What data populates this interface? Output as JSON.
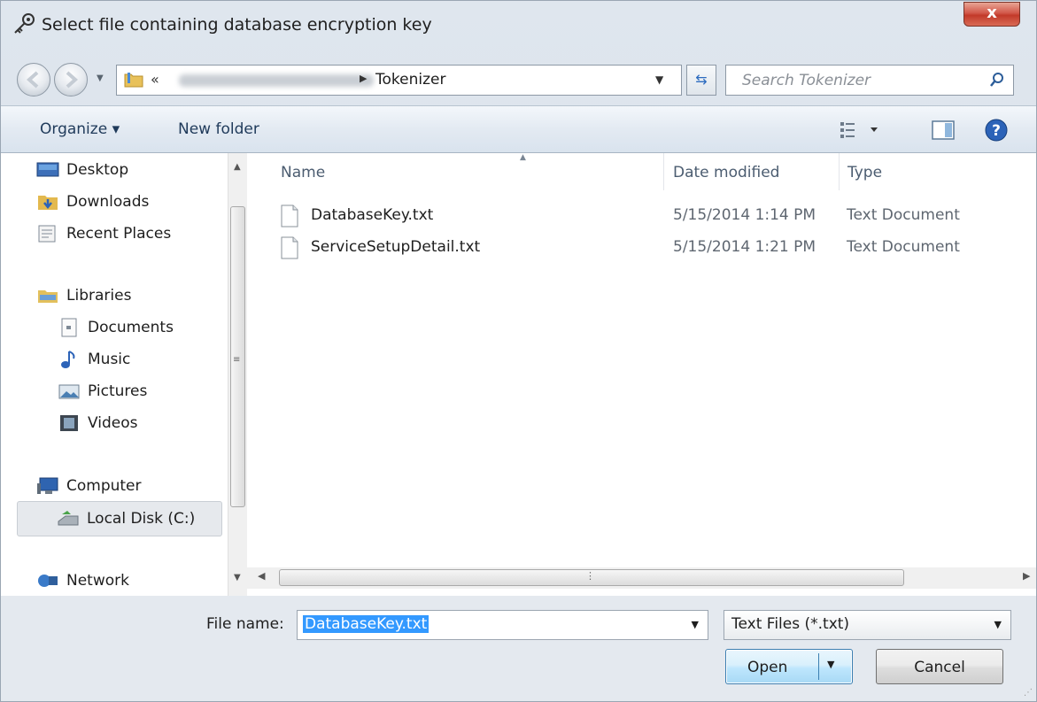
{
  "window": {
    "title": "Select file containing database encryption key",
    "close_label": "x"
  },
  "address": {
    "prefix": "«",
    "current_folder": "Tokenizer",
    "search_placeholder": "Search Tokenizer"
  },
  "toolbar": {
    "organize_label": "Organize ▾",
    "new_folder_label": "New folder"
  },
  "navpane": {
    "items": [
      {
        "label": "Desktop",
        "icon": "desktop-icon"
      },
      {
        "label": "Downloads",
        "icon": "downloads-icon"
      },
      {
        "label": "Recent Places",
        "icon": "recent-places-icon"
      },
      {
        "label": "Libraries",
        "icon": "libraries-icon"
      },
      {
        "label": "Documents",
        "icon": "documents-icon"
      },
      {
        "label": "Music",
        "icon": "music-icon"
      },
      {
        "label": "Pictures",
        "icon": "pictures-icon"
      },
      {
        "label": "Videos",
        "icon": "videos-icon"
      },
      {
        "label": "Computer",
        "icon": "computer-icon"
      },
      {
        "label": "Local Disk (C:)",
        "icon": "local-disk-icon"
      },
      {
        "label": "Network",
        "icon": "network-icon"
      }
    ],
    "selected": "Local Disk (C:)"
  },
  "files": {
    "columns": [
      "Name",
      "Date modified",
      "Type"
    ],
    "rows": [
      {
        "name": "DatabaseKey.txt",
        "date": "5/15/2014 1:14 PM",
        "type": "Text Document"
      },
      {
        "name": "ServiceSetupDetail.txt",
        "date": "5/15/2014 1:21 PM",
        "type": "Text Document"
      }
    ]
  },
  "footer": {
    "file_name_label": "File name:",
    "file_name_value": "DatabaseKey.txt",
    "file_type_value": "Text Files (*.txt)",
    "open_label": "Open",
    "cancel_label": "Cancel"
  },
  "colors": {
    "selection": "#3399ff",
    "close_button": "#c23a2a",
    "toolbar_text": "#1f3a5a"
  }
}
